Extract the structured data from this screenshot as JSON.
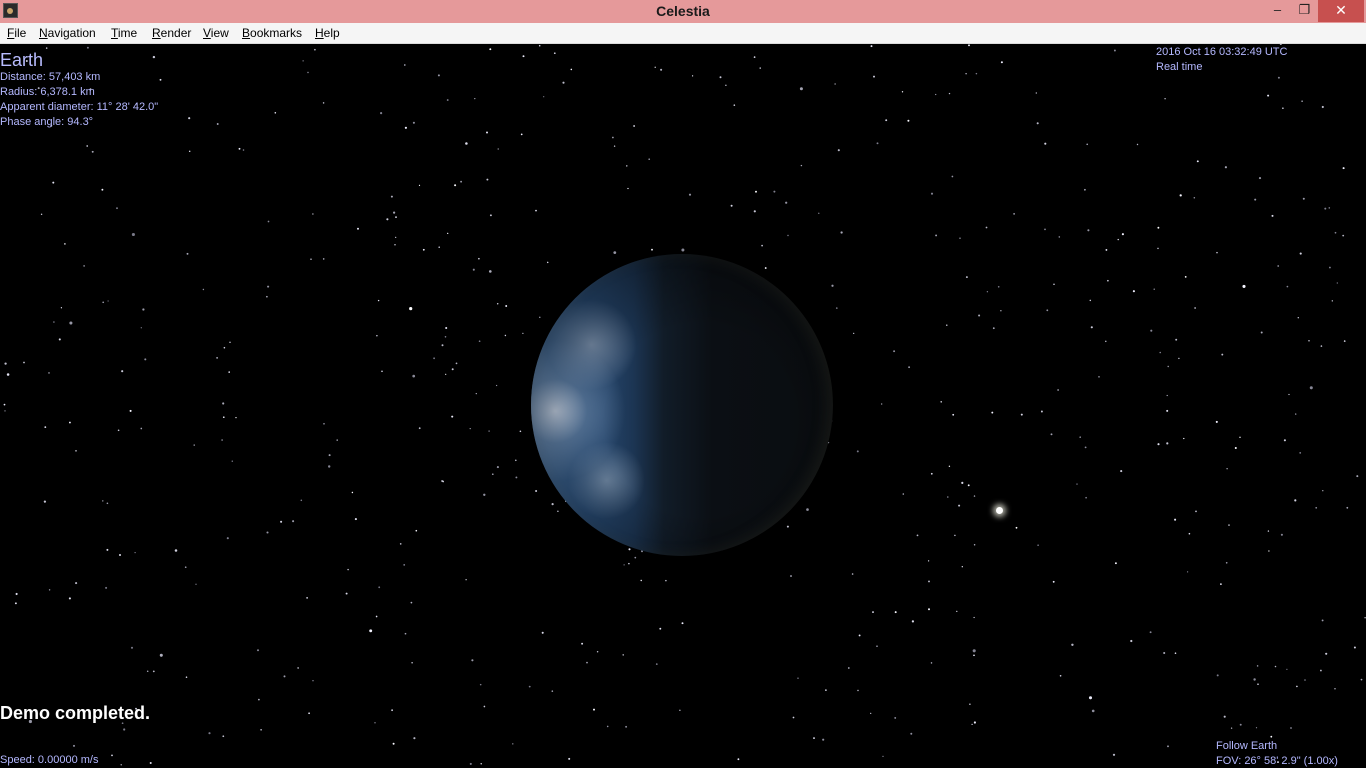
{
  "window": {
    "title": "Celestia",
    "minimize_glyph": "–",
    "restore_glyph": "❐",
    "close_glyph": "✕"
  },
  "menu": {
    "items": [
      {
        "first": "F",
        "rest": "ile"
      },
      {
        "first": "N",
        "rest": "avigation"
      },
      {
        "first": "T",
        "rest": "ime"
      },
      {
        "first": "R",
        "rest": "ender"
      },
      {
        "first": "V",
        "rest": "iew"
      },
      {
        "first": "B",
        "rest": "ookmarks"
      },
      {
        "first": "H",
        "rest": "elp"
      }
    ]
  },
  "object_info": {
    "name": "Earth",
    "distance": "Distance: 57,403 km",
    "radius": "Radius: 6,378.1 km",
    "apparent_diameter": "Apparent diameter: 11° 28' 42.0\"",
    "phase_angle": "Phase angle: 94.3°"
  },
  "time_info": {
    "datetime": "2016 Oct 16 03:32:49 UTC",
    "rate": "Real time"
  },
  "status_message": "Demo completed.",
  "speed": "Speed: 0.00000 m/s",
  "view_info": {
    "mode": "Follow Earth",
    "fov": "FOV: 26° 58' 2.9\" (1.00x)"
  },
  "colors": {
    "titlebar": "#e5999a",
    "hud_text": "#b4b8ff",
    "status_text": "#ffffff",
    "space": "#000000"
  }
}
